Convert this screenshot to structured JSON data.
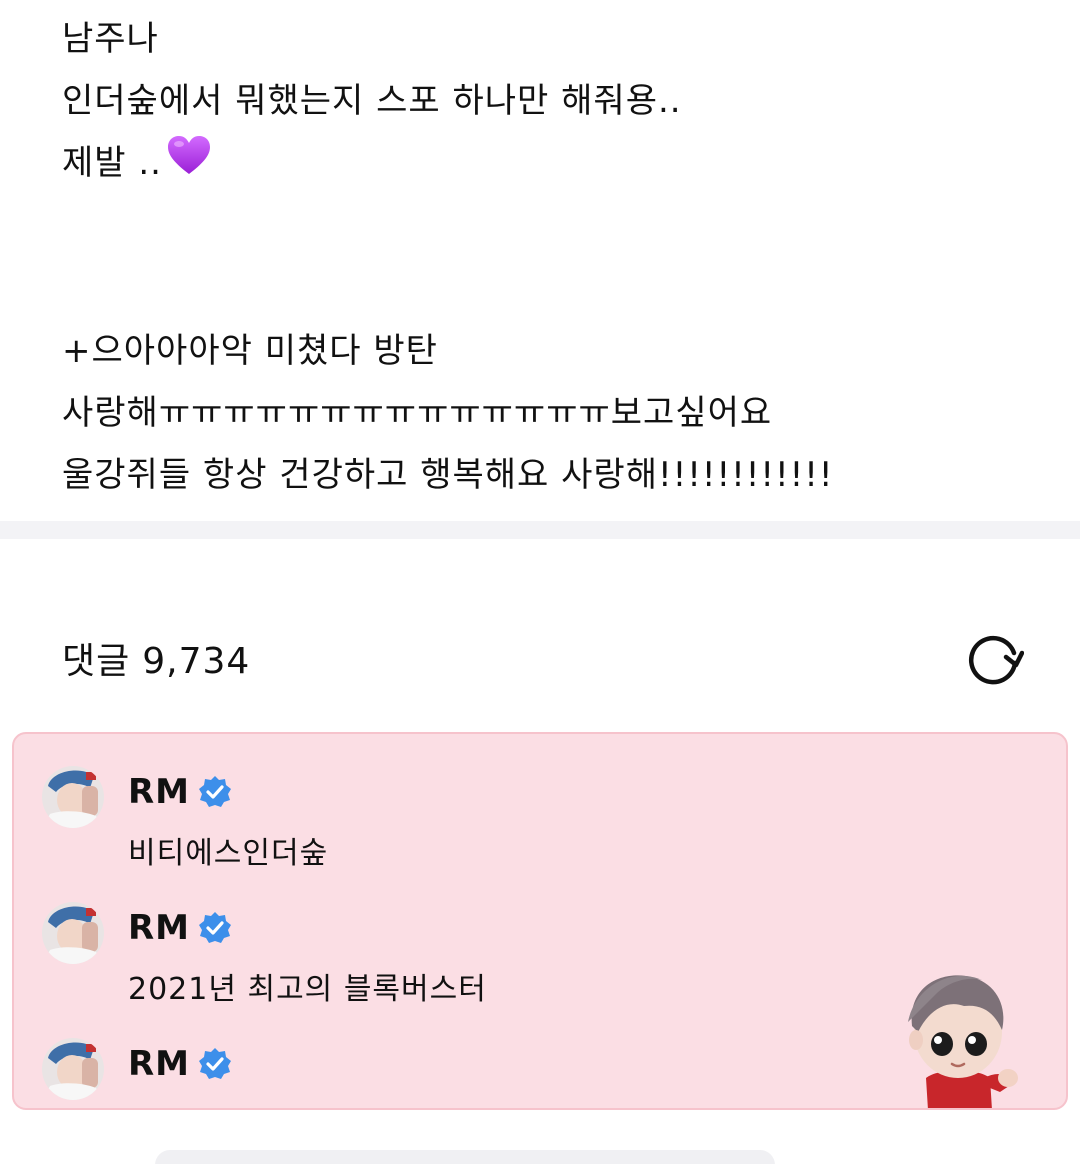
{
  "post": {
    "lines": [
      "남주나",
      "인더숲에서 뭐했는지 스포 하나만 해줘용..",
      "제발 ..",
      "+으아아아악 미쳤다 방탄",
      "사랑해ㅠㅠㅠㅠㅠㅠㅠㅠㅠㅠㅠㅠㅠㅠ보고싶어요",
      "울강쥐들 항상 건강하고 행복해요 사랑해!!!!!!!!!!!!"
    ],
    "emoji": "purple-heart"
  },
  "comments": {
    "label": "댓글",
    "count": "9,734",
    "refresh_icon": "refresh-icon"
  },
  "artist_comments": [
    {
      "author": "RM",
      "verified": true,
      "text": "비티에스인더숲"
    },
    {
      "author": "RM",
      "verified": true,
      "text": "2021년 최고의 블록버스터"
    },
    {
      "author": "RM",
      "verified": true,
      "text": ""
    }
  ],
  "colors": {
    "artist_bg": "#fbdee4",
    "artist_border": "#f6c3cc",
    "verified": "#3d8fea",
    "heart": "#b23ee6"
  }
}
